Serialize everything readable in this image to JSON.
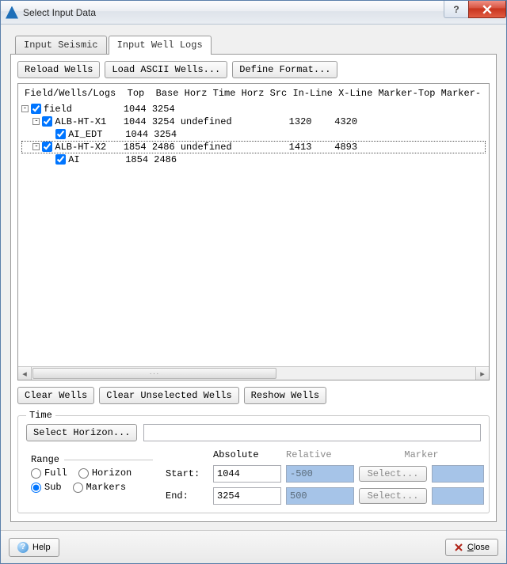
{
  "window": {
    "title": "Select Input Data"
  },
  "tabs": {
    "seismic": "Input Seismic",
    "wells": "Input Well Logs"
  },
  "toolbar": {
    "reload": "Reload Wells",
    "load_ascii": "Load ASCII Wells...",
    "define_format": "Define Format..."
  },
  "tree": {
    "headers": [
      "Field/Wells/Logs",
      "Top",
      "Base",
      "Horz Time",
      "Horz Src",
      "In-Line",
      "X-Line",
      "Marker-Top",
      "Marker-"
    ],
    "rows": [
      {
        "indent": 0,
        "expander": "-",
        "checked": true,
        "name": "field",
        "top": "1044",
        "base": "3254",
        "horz": "",
        "src": "",
        "inline": "",
        "xline": "",
        "sel": false
      },
      {
        "indent": 1,
        "expander": "-",
        "checked": true,
        "name": "ALB-HT-X1",
        "top": "1044",
        "base": "3254",
        "horz": "undefined",
        "src": "",
        "inline": "1320",
        "xline": "4320",
        "sel": false
      },
      {
        "indent": 2,
        "expander": "",
        "checked": true,
        "name": "AI_EDT",
        "top": "1044",
        "base": "3254",
        "horz": "",
        "src": "",
        "inline": "",
        "xline": "",
        "sel": false
      },
      {
        "indent": 1,
        "expander": "-",
        "checked": true,
        "name": "ALB-HT-X2",
        "top": "1854",
        "base": "2486",
        "horz": "undefined",
        "src": "",
        "inline": "1413",
        "xline": "4893",
        "sel": true
      },
      {
        "indent": 2,
        "expander": "",
        "checked": true,
        "name": "AI",
        "top": "1854",
        "base": "2486",
        "horz": "",
        "src": "",
        "inline": "",
        "xline": "",
        "sel": false
      }
    ]
  },
  "toolbar2": {
    "clear_wells": "Clear Wells",
    "clear_unselected": "Clear Unselected Wells",
    "reshow": "Reshow Wells"
  },
  "time": {
    "legend": "Time",
    "select_horizon": "Select Horizon...",
    "horizon_value": "",
    "range": {
      "legend": "Range",
      "full": "Full",
      "horizon": "Horizon",
      "sub": "Sub",
      "markers": "Markers",
      "selected": "sub"
    },
    "cols": {
      "absolute": "Absolute",
      "relative": "Relative",
      "marker": "Marker"
    },
    "start_label": "Start:",
    "end_label": "End:",
    "start_abs": "1044",
    "end_abs": "3254",
    "start_rel": "-500",
    "end_rel": "500",
    "select_btn": "Select..."
  },
  "footer": {
    "help": "Help",
    "close": "Close"
  }
}
